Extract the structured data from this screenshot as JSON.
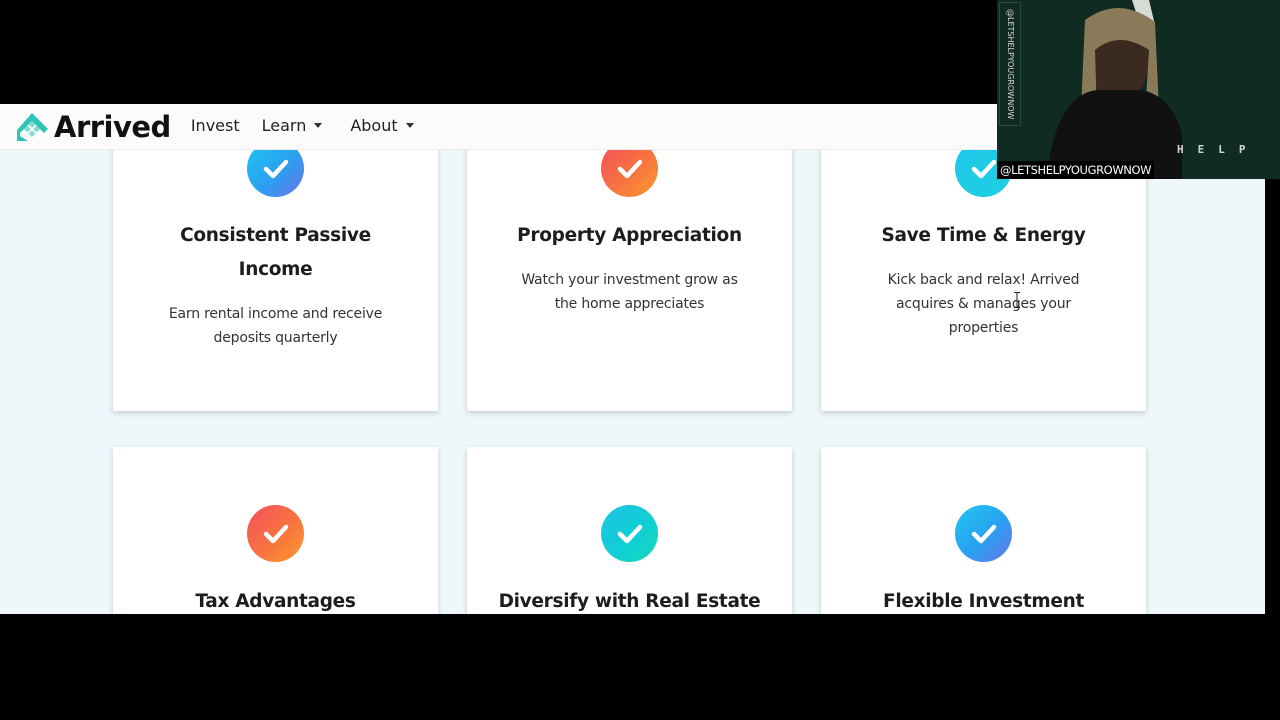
{
  "navbar": {
    "brand": "Arrived",
    "items": [
      {
        "label": "Invest",
        "has_dropdown": false
      },
      {
        "label": "Learn",
        "has_dropdown": true
      },
      {
        "label": "About",
        "has_dropdown": true
      }
    ]
  },
  "colors": {
    "brand_teal": "#2ec4b6",
    "page_background": "#eef8fb",
    "card_background": "#ffffff",
    "heading_text": "#1d1d1d"
  },
  "features": [
    {
      "title": "Consistent Passive Income",
      "description": "Earn rental income and receive deposits quarterly",
      "icon": "check-circle-icon",
      "gradient": "blue"
    },
    {
      "title": "Property Appreciation",
      "description": "Watch your investment grow as the home appreciates",
      "icon": "check-circle-icon",
      "gradient": "orange"
    },
    {
      "title": "Save Time & Energy",
      "description": "Kick back and relax! Arrived acquires & manages your properties",
      "icon": "check-circle-icon",
      "gradient": "cyan"
    },
    {
      "title": "Tax Advantages",
      "description": "",
      "icon": "check-circle-icon",
      "gradient": "orange"
    },
    {
      "title": "Diversify with Real Estate",
      "description": "",
      "icon": "check-circle-icon",
      "gradient": "teal"
    },
    {
      "title": "Flexible Investment",
      "description": "",
      "icon": "check-circle-icon",
      "gradient": "blue"
    }
  ],
  "webcam_overlay": {
    "vertical_handle": "@LETSHELPYOUGROWNOW",
    "handle": "@LETSHELPYOUGROWNOW",
    "background_text": "HELP"
  }
}
